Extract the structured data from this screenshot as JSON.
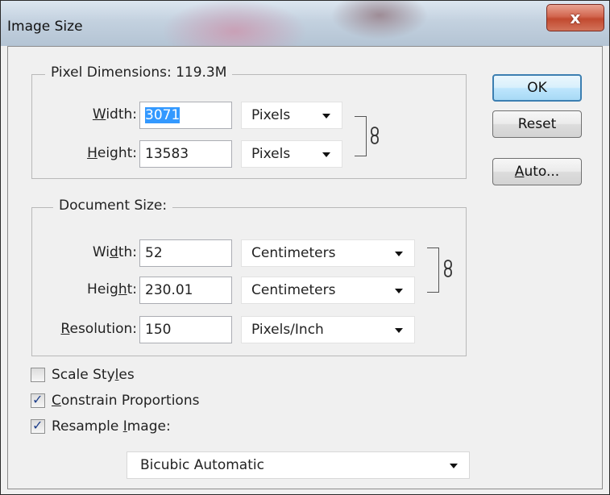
{
  "window": {
    "title": "Image Size",
    "close_glyph": "x"
  },
  "pixel_dimensions": {
    "legend": "Pixel Dimensions:",
    "size_value": "119.3M",
    "width": {
      "label_pre": "",
      "label_u": "W",
      "label_post": "idth:",
      "value": "3071",
      "unit": "Pixels"
    },
    "height": {
      "label_pre": "",
      "label_u": "H",
      "label_post": "eight:",
      "value": "13583",
      "unit": "Pixels"
    }
  },
  "document_size": {
    "legend": "Document Size:",
    "width": {
      "label_pre": "Wi",
      "label_u": "d",
      "label_post": "th:",
      "value": "52",
      "unit": "Centimeters"
    },
    "height": {
      "label_pre": "Heig",
      "label_u": "h",
      "label_post": "t:",
      "value": "230.01",
      "unit": "Centimeters"
    },
    "resolution": {
      "label_pre": "",
      "label_u": "R",
      "label_post": "esolution:",
      "value": "150",
      "unit": "Pixels/Inch"
    }
  },
  "buttons": {
    "ok": "OK",
    "reset": "Reset",
    "auto_u": "A",
    "auto_post": "uto..."
  },
  "options": {
    "scale_styles": {
      "pre": "Scale Sty",
      "u": "l",
      "post": "es",
      "checked": false
    },
    "constrain": {
      "pre": "",
      "u": "C",
      "post": "onstrain Proportions",
      "checked": true
    },
    "resample": {
      "pre": "Resample ",
      "u": "I",
      "post": "mage:",
      "checked": true
    }
  },
  "resample_method": "Bicubic Automatic",
  "colors": {
    "selection": "#3399ff",
    "ok_border": "#3c7fb1",
    "close_red": "#c24a30"
  }
}
